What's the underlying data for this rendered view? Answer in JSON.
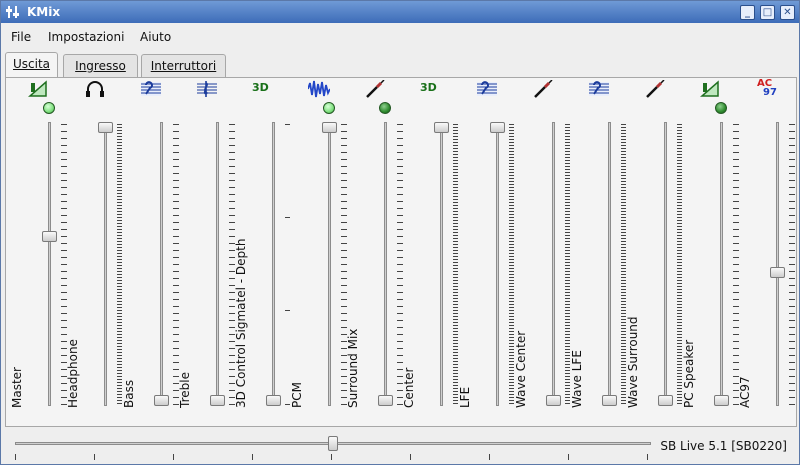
{
  "window": {
    "title": "KMix",
    "buttons": {
      "minimize": "_",
      "maximize": "□",
      "close": "✕"
    }
  },
  "menu": {
    "file": "File",
    "settings": "Impostazioni",
    "help": "Aiuto"
  },
  "tabs": [
    {
      "label": "Uscita",
      "active": true
    },
    {
      "label": "Ingresso",
      "active": false
    },
    {
      "label": "Interruttori",
      "active": false
    }
  ],
  "channels": [
    {
      "label": "Master",
      "icon": "volume-icon",
      "led": "on",
      "level": 0.6,
      "ticks": "normal"
    },
    {
      "label": "Headphone",
      "icon": "headphone-icon",
      "led": "none",
      "level": 1.0,
      "ticks": "dense"
    },
    {
      "label": "Bass",
      "icon": "bass-clef-icon",
      "led": "none",
      "level": 0.0,
      "ticks": "normal"
    },
    {
      "label": "Treble",
      "icon": "treble-clef-icon",
      "led": "none",
      "level": 0.0,
      "ticks": "normal"
    },
    {
      "label": "3D Control Sigmatel - Depth",
      "icon": "3d-icon",
      "led": "none",
      "level": 0.0,
      "ticks": "sparse"
    },
    {
      "label": "PCM",
      "icon": "waveform-icon",
      "led": "on",
      "level": 1.0,
      "ticks": "normal"
    },
    {
      "label": "Surround Mix",
      "icon": "jack-plug-icon",
      "led": "on-dark",
      "level": 0.0,
      "ticks": "normal"
    },
    {
      "label": "Center",
      "icon": "3d-icon",
      "led": "none",
      "level": 1.0,
      "ticks": "dense"
    },
    {
      "label": "LFE",
      "icon": "bass-clef-icon",
      "led": "none",
      "level": 1.0,
      "ticks": "dense"
    },
    {
      "label": "Wave Center",
      "icon": "jack-plug-icon",
      "led": "none",
      "level": 0.0,
      "ticks": "dense"
    },
    {
      "label": "Wave LFE",
      "icon": "bass-clef-icon",
      "led": "none",
      "level": 0.0,
      "ticks": "dense"
    },
    {
      "label": "Wave Surround",
      "icon": "jack-plug-icon",
      "led": "none",
      "level": 0.0,
      "ticks": "dense"
    },
    {
      "label": "PC Speaker",
      "icon": "volume-icon",
      "led": "on-dark",
      "level": 0.0,
      "ticks": "normal"
    },
    {
      "label": "AC97",
      "icon": "ac97-icon",
      "led": "none",
      "level": 0.47,
      "ticks": "normal",
      "icon_text_top": "AC",
      "icon_text_bottom": "97"
    }
  ],
  "icon_3d_text": "3D",
  "colors": {
    "led_on": "#7ee07e",
    "led_dark": "#2e8b2e",
    "accent": "#3d6cb8"
  },
  "status": {
    "device": "SB Live 5.1 [SB0220]",
    "master_balance": 0.5
  }
}
